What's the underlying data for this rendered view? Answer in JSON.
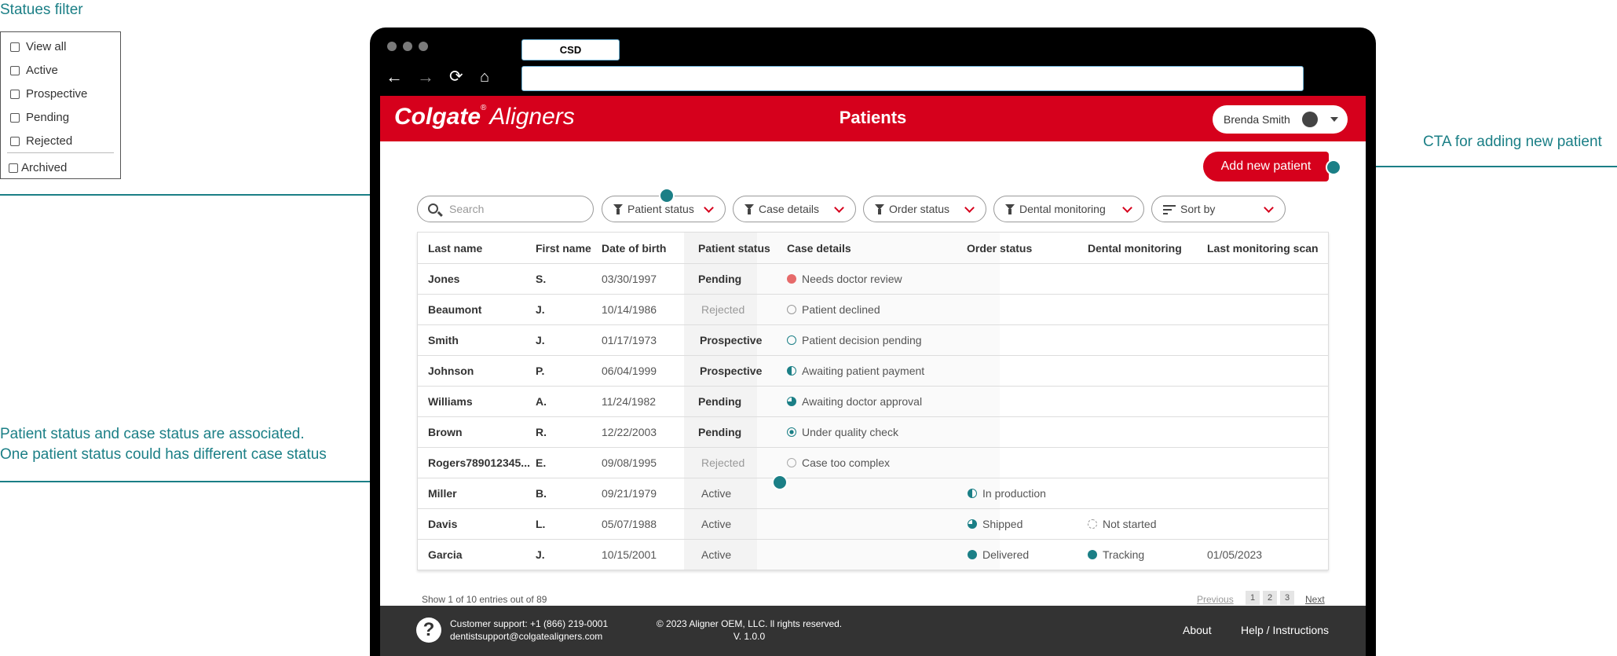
{
  "annotations": {
    "filter_title": "Statues filter",
    "filter_options": [
      "View all",
      "Active",
      "Prospective",
      "Pending",
      "Rejected",
      "Archived"
    ],
    "cta_note": "CTA for adding new patient",
    "status_note_line1": "Patient status and case status are associated.",
    "status_note_line2": "One patient status could has different case status"
  },
  "browser": {
    "tab_title": "CSD",
    "url": ""
  },
  "header": {
    "brand": "Colgate",
    "brand_suffix": "Aligners",
    "title": "Patients",
    "user_name": "Brenda Smith"
  },
  "toolbar": {
    "add_label": "Add new patient",
    "search_placeholder": "Search",
    "filters": [
      "Patient status",
      "Case details",
      "Order status",
      "Dental monitoring",
      "Sort by"
    ]
  },
  "table": {
    "columns": [
      "Last name",
      "First name",
      "Date of birth",
      "Patient status",
      "Case details",
      "Order status",
      "Dental monitoring",
      "Last monitoring scan"
    ],
    "rows": [
      {
        "last": "Jones",
        "first": "S.",
        "dob": "03/30/1997",
        "status": "Pending",
        "case": "Needs doctor review",
        "order": "",
        "dental": "",
        "scan": ""
      },
      {
        "last": "Beaumont",
        "first": "J.",
        "dob": "10/14/1986",
        "status": "Rejected",
        "case": "Patient declined",
        "order": "",
        "dental": "",
        "scan": ""
      },
      {
        "last": "Smith",
        "first": "J.",
        "dob": "01/17/1973",
        "status": "Prospective",
        "case": "Patient decision pending",
        "order": "",
        "dental": "",
        "scan": ""
      },
      {
        "last": "Johnson",
        "first": "P.",
        "dob": "06/04/1999",
        "status": "Prospective",
        "case": "Awaiting patient payment",
        "order": "",
        "dental": "",
        "scan": ""
      },
      {
        "last": "Williams",
        "first": "A.",
        "dob": "11/24/1982",
        "status": "Pending",
        "case": "Awaiting doctor approval",
        "order": "",
        "dental": "",
        "scan": ""
      },
      {
        "last": "Brown",
        "first": "R.",
        "dob": "12/22/2003",
        "status": "Pending",
        "case": "Under quality check",
        "order": "",
        "dental": "",
        "scan": ""
      },
      {
        "last": "Rogers789012345...",
        "first": "E.",
        "dob": "09/08/1995",
        "status": "Rejected",
        "case": "Case too complex",
        "order": "",
        "dental": "",
        "scan": ""
      },
      {
        "last": "Miller",
        "first": "B.",
        "dob": "09/21/1979",
        "status": "Active",
        "case": "",
        "order": "In production",
        "dental": "",
        "scan": ""
      },
      {
        "last": "Davis",
        "first": "L.",
        "dob": "05/07/1988",
        "status": "Active",
        "case": "",
        "order": "Shipped",
        "dental": "Not started",
        "scan": ""
      },
      {
        "last": "Garcia",
        "first": "J.",
        "dob": "10/15/2001",
        "status": "Active",
        "case": "",
        "order": "Delivered",
        "dental": "Tracking",
        "scan": "01/05/2023"
      }
    ]
  },
  "pagination": {
    "summary": "Show 1 of 10 entries out of 89",
    "previous": "Previous",
    "pages": [
      "1",
      "2",
      "3"
    ],
    "next": "Next"
  },
  "footer": {
    "support_phone": "Customer support: +1 (866) 219-0001",
    "support_email": "dentistsupport@colgatealigners.com",
    "copyright": "© 2023 Aligner OEM, LLC. ll rights reserved.",
    "version": "V. 1.0.0",
    "about": "About",
    "help": "Help / Instructions"
  },
  "colors": {
    "brand_red": "#d6001c",
    "annotation_teal": "#1b7f86",
    "footer_bg": "#333333"
  }
}
